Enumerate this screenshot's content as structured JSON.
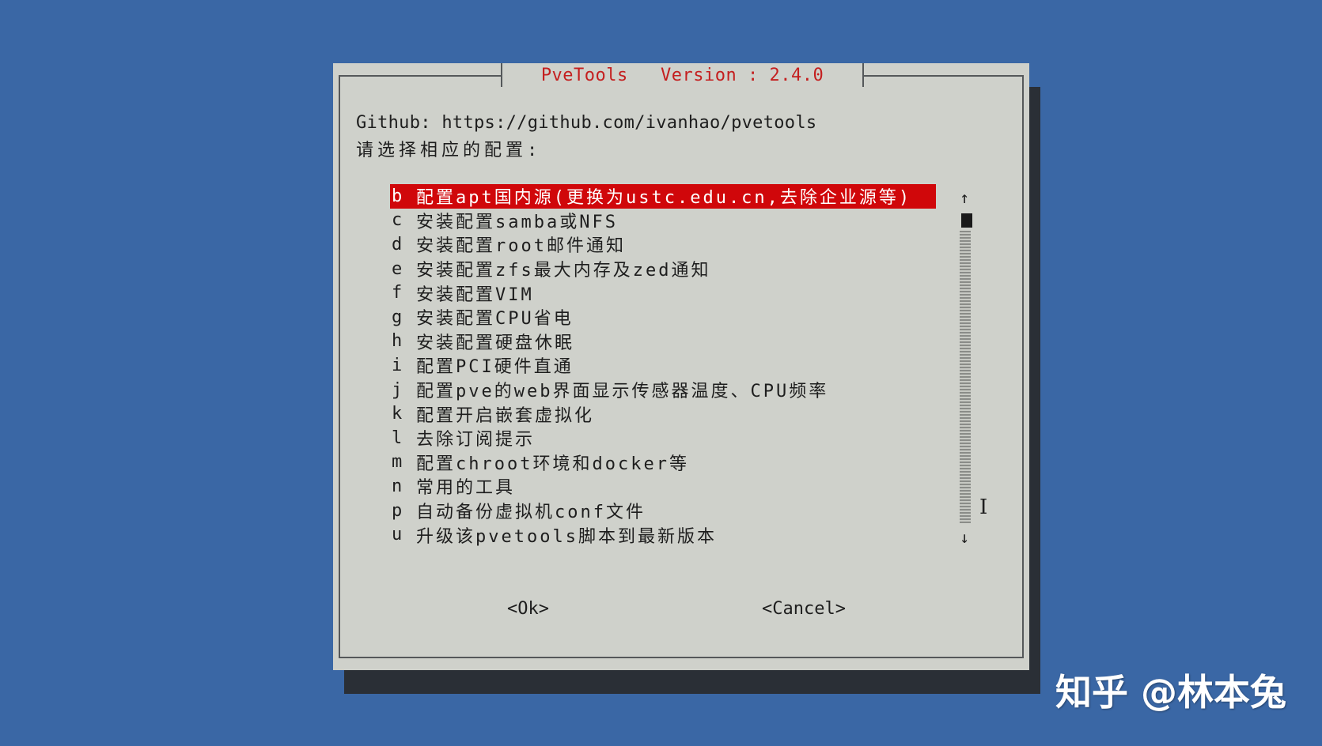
{
  "dialog": {
    "title": "PveTools   Version : 2.4.0",
    "github_line": "Github: https://github.com/ivanhao/pvetools",
    "prompt": "请选择相应的配置:",
    "menu": [
      {
        "key": "b",
        "label": "配置apt国内源(更换为ustc.edu.cn,去除企业源等)",
        "selected": true
      },
      {
        "key": "c",
        "label": "安装配置samba或NFS",
        "selected": false
      },
      {
        "key": "d",
        "label": "安装配置root邮件通知",
        "selected": false
      },
      {
        "key": "e",
        "label": "安装配置zfs最大内存及zed通知",
        "selected": false
      },
      {
        "key": "f",
        "label": "安装配置VIM",
        "selected": false
      },
      {
        "key": "g",
        "label": "安装配置CPU省电",
        "selected": false
      },
      {
        "key": "h",
        "label": "安装配置硬盘休眠",
        "selected": false
      },
      {
        "key": "i",
        "label": "配置PCI硬件直通",
        "selected": false
      },
      {
        "key": "j",
        "label": "配置pve的web界面显示传感器温度、CPU频率",
        "selected": false
      },
      {
        "key": "k",
        "label": "配置开启嵌套虚拟化",
        "selected": false
      },
      {
        "key": "l",
        "label": "去除订阅提示",
        "selected": false
      },
      {
        "key": "m",
        "label": "配置chroot环境和docker等",
        "selected": false
      },
      {
        "key": "n",
        "label": "常用的工具",
        "selected": false
      },
      {
        "key": "p",
        "label": "自动备份虚拟机conf文件",
        "selected": false
      },
      {
        "key": "u",
        "label": "升级该pvetools脚本到最新版本",
        "selected": false
      }
    ],
    "scroll_up": "↑",
    "scroll_down": "↓",
    "ok_label": "<Ok>",
    "cancel_label": "<Cancel>"
  },
  "watermark": "知乎 @林本兔",
  "colors": {
    "desktop": "#3a67a5",
    "dialog_bg": "#cfd1cb",
    "title_text": "#c41f1f",
    "selection": "#d0070a"
  }
}
